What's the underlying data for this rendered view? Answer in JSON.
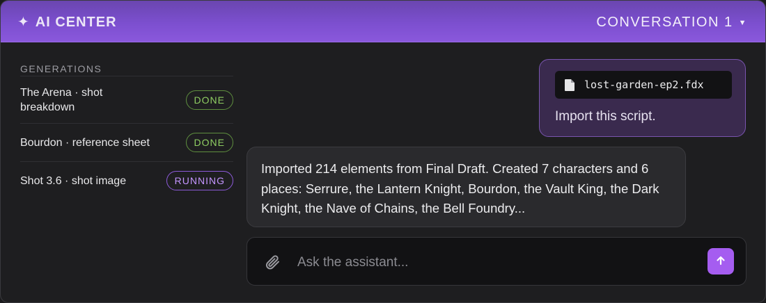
{
  "header": {
    "brand_icon": "sparkle-icon",
    "brand_label": "AI CENTER",
    "conversation_label": "CONVERSATION 1",
    "conversation_icon": "caret-down-icon"
  },
  "sidebar": {
    "title": "GENERATIONS",
    "items": [
      {
        "label": "The Arena · shot breakdown",
        "status": "DONE"
      },
      {
        "label": "Bourdon · reference sheet",
        "status": "DONE"
      },
      {
        "label": "Shot 3.6 · shot image",
        "status": "RUNNING"
      }
    ]
  },
  "chat": {
    "user_message": {
      "attachment_icon": "file-icon",
      "attachment_name": "lost-garden-ep2.fdx",
      "text": "Import this script."
    },
    "assistant_message": {
      "text": "Imported 214 elements from Final Draft. Created 7 characters and 6 places: Serrure, the Lantern Knight, Bourdon, the Vault King, the Dark Knight, the Nave of Chains, the Bell Foundry..."
    }
  },
  "composer": {
    "attach_icon": "paperclip-icon",
    "placeholder": "Ask the assistant...",
    "value": "",
    "send_icon": "arrow-up-icon"
  },
  "colors": {
    "accent": "#a55df0",
    "header_gradient_start": "#6a46b0",
    "header_gradient_end": "#8a58dc",
    "done": "#8fce63",
    "running": "#c495ff",
    "background": "#1e1e20"
  }
}
